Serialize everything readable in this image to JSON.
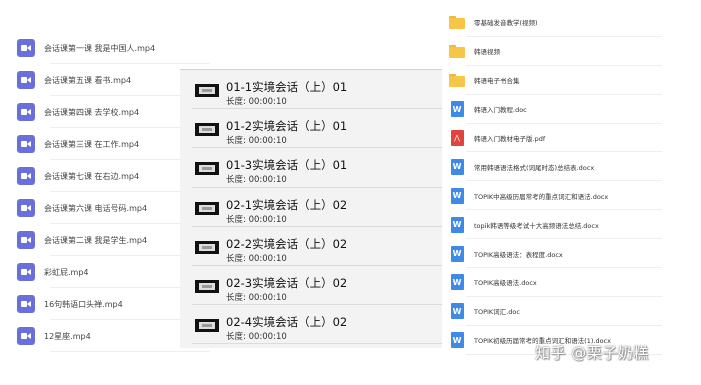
{
  "left_panel": {
    "items": [
      {
        "name": "会话课第一课 我是中国人.mp4",
        "icon": "video-file-icon"
      },
      {
        "name": "会话课第五课 看书.mp4",
        "icon": "video-file-icon"
      },
      {
        "name": "会话课第四课 去学校.mp4",
        "icon": "video-file-icon"
      },
      {
        "name": "会话课第三课 在工作.mp4",
        "icon": "video-file-icon"
      },
      {
        "name": "会话课第七课 在右边.mp4",
        "icon": "video-file-icon"
      },
      {
        "name": "会话课第六课 电话号码.mp4",
        "icon": "video-file-icon"
      },
      {
        "name": "会话课第二课 我是学生.mp4",
        "icon": "video-file-icon"
      },
      {
        "name": "彩虹屁.mp4",
        "icon": "video-file-icon"
      },
      {
        "name": "16句韩语口头禅.mp4",
        "icon": "video-file-icon"
      },
      {
        "name": "12星座.mp4",
        "icon": "video-file-icon"
      }
    ]
  },
  "middle_panel": {
    "duration_label": "长度:",
    "items": [
      {
        "title": "01-1实境会话（上）01",
        "duration": "00:00:10"
      },
      {
        "title": "01-2实境会话（上）01",
        "duration": "00:00:10"
      },
      {
        "title": "01-3实境会话（上）01",
        "duration": "00:00:10"
      },
      {
        "title": "02-1实境会话（上）02",
        "duration": "00:00:10"
      },
      {
        "title": "02-2实境会话（上）02",
        "duration": "00:00:10"
      },
      {
        "title": "02-3实境会话（上）02",
        "duration": "00:00:10"
      },
      {
        "title": "02-4实境会话（上）02",
        "duration": "00:00:10"
      }
    ]
  },
  "right_panel": {
    "items": [
      {
        "name": "零基础发音教学(视频)",
        "type": "folder"
      },
      {
        "name": "韩语视频",
        "type": "folder"
      },
      {
        "name": "韩语电子书合集",
        "type": "folder"
      },
      {
        "name": "韩语入门教程.doc",
        "type": "word"
      },
      {
        "name": "韩语入门教材电子版.pdf",
        "type": "pdf"
      },
      {
        "name": "常用韩语语法格式(词尾时态)总结表.docx",
        "type": "word"
      },
      {
        "name": "TOPIK中高级历届常考的重点词汇和语法.docx",
        "type": "word"
      },
      {
        "name": "topik韩语等级考试十大高频语法总结.docx",
        "type": "word"
      },
      {
        "name": "TOPIK高级语法：表程度.docx",
        "type": "word"
      },
      {
        "name": "TOPIK高级语法.docx",
        "type": "word"
      },
      {
        "name": "TOPIK词汇.doc",
        "type": "word"
      },
      {
        "name": "TOPIK初级历届常考的重点词汇和语法(1).docx",
        "type": "word"
      }
    ]
  },
  "icons": {
    "word_letter": "W",
    "pdf_letter": "⋀"
  },
  "colors": {
    "video_icon": "#6b6fdc",
    "folder": "#f7c548",
    "word": "#3f8ae6",
    "pdf": "#e0443c"
  },
  "watermark": "知乎 @栗子奶糕"
}
